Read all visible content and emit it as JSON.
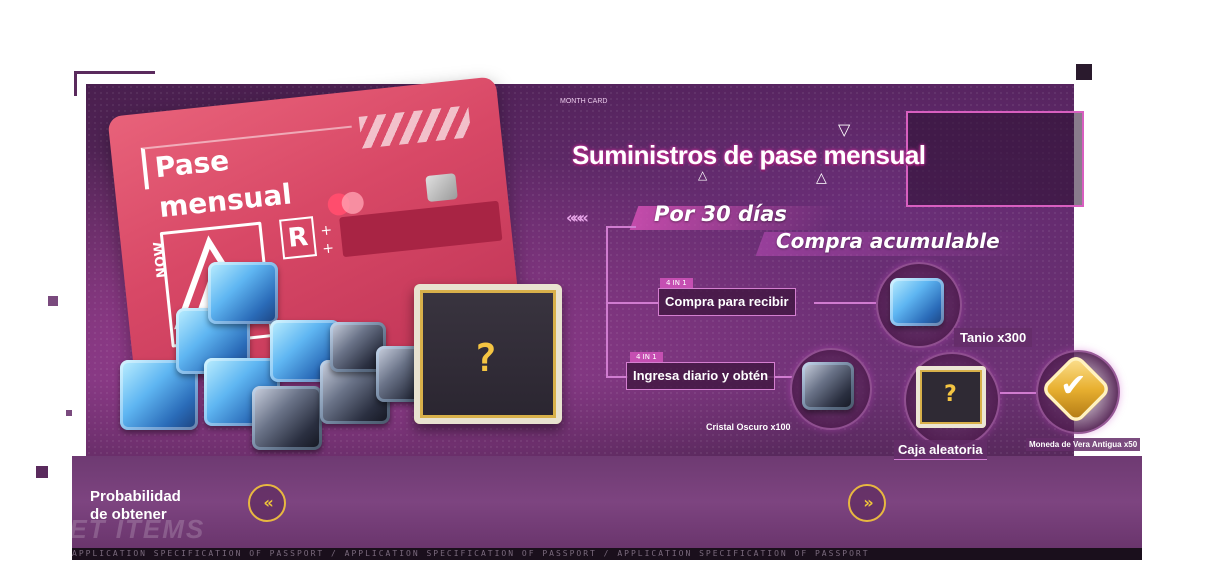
{
  "card": {
    "title": "Pase mensual",
    "brand_mark": "NOW",
    "letter": "R",
    "plus": "+"
  },
  "header": {
    "small_tag": "MONTH CARD",
    "title": "Suministros de pase mensual",
    "subtitle_1": "Por 30 días",
    "subtitle_2": "Compra acumulable",
    "chevrons": "«««"
  },
  "rewards": {
    "row1": {
      "tag": "4 IN 1",
      "label": "Compra para recibir",
      "items": [
        {
          "name": "Tanio x300",
          "icon": "blue-crystal-icon"
        }
      ]
    },
    "row2": {
      "tag": "4 IN 1",
      "label": "Ingresa diario y obtén",
      "items": [
        {
          "name": "Cristal Oscuro x100",
          "icon": "dark-crystal-icon"
        },
        {
          "name": "Caja aleatoria",
          "icon": "random-box-icon"
        },
        {
          "name": "Moneda de Vera Antigua x50",
          "icon": "gold-coin-icon"
        }
      ]
    }
  },
  "footer": {
    "probability_line1": "Probabilidad",
    "probability_line2": "de obtener",
    "prev_label": "«",
    "next_label": "»",
    "watermark": "SET ITEMS",
    "strip_text": "APPLICATION SPECIFICATION OF PASSPORT  /  APPLICATION SPECIFICATION OF PASSPORT  /  APPLICATION SPECIFICATION OF PASSPORT"
  },
  "colors": {
    "accent_pink": "#d85fc0",
    "panel_purple": "#5a2a5d",
    "gold": "#f0c53a"
  }
}
